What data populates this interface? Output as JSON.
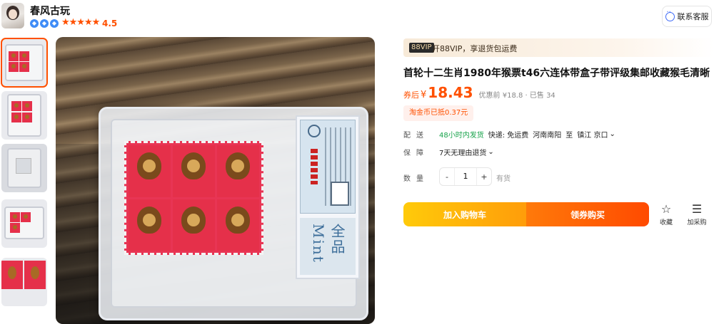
{
  "shop": {
    "name": "春风古玩",
    "rating": "4.5",
    "stars": "★★★★★",
    "service_label": "联系客服"
  },
  "vip": {
    "tag": "88VIP",
    "text": "开88VIP，享退货包运费"
  },
  "product": {
    "title": "首轮十二生肖1980年猴票t46六连体带盒子带评级集邮收藏猴毛清晰",
    "price_label": "券后",
    "currency": "¥",
    "price": "18.43",
    "price_before": "优惠前 ¥18.8 · 已售 34",
    "coin_note": "淘金币已抵0.37元"
  },
  "shipping": {
    "label": "配送",
    "speed": "48小时内发货",
    "fee": "快递: 免运费",
    "from": "河南南阳",
    "to_word": "至",
    "to": "镇江 京口"
  },
  "guarantee": {
    "label": "保障",
    "text": "7天无理由退货"
  },
  "quantity": {
    "label": "数量",
    "minus": "-",
    "value": "1",
    "plus": "+",
    "stock": "有货"
  },
  "actions": {
    "add_to_cart": "加入购物车",
    "buy_now": "领券购买",
    "favorite": "收藏",
    "add_purchase": "加采购"
  },
  "image": {
    "cert_text": "全品 Mint"
  },
  "colors": {
    "accent": "#ff5000",
    "cart": "#ffb20a",
    "shipping_green": "#17a34a"
  }
}
